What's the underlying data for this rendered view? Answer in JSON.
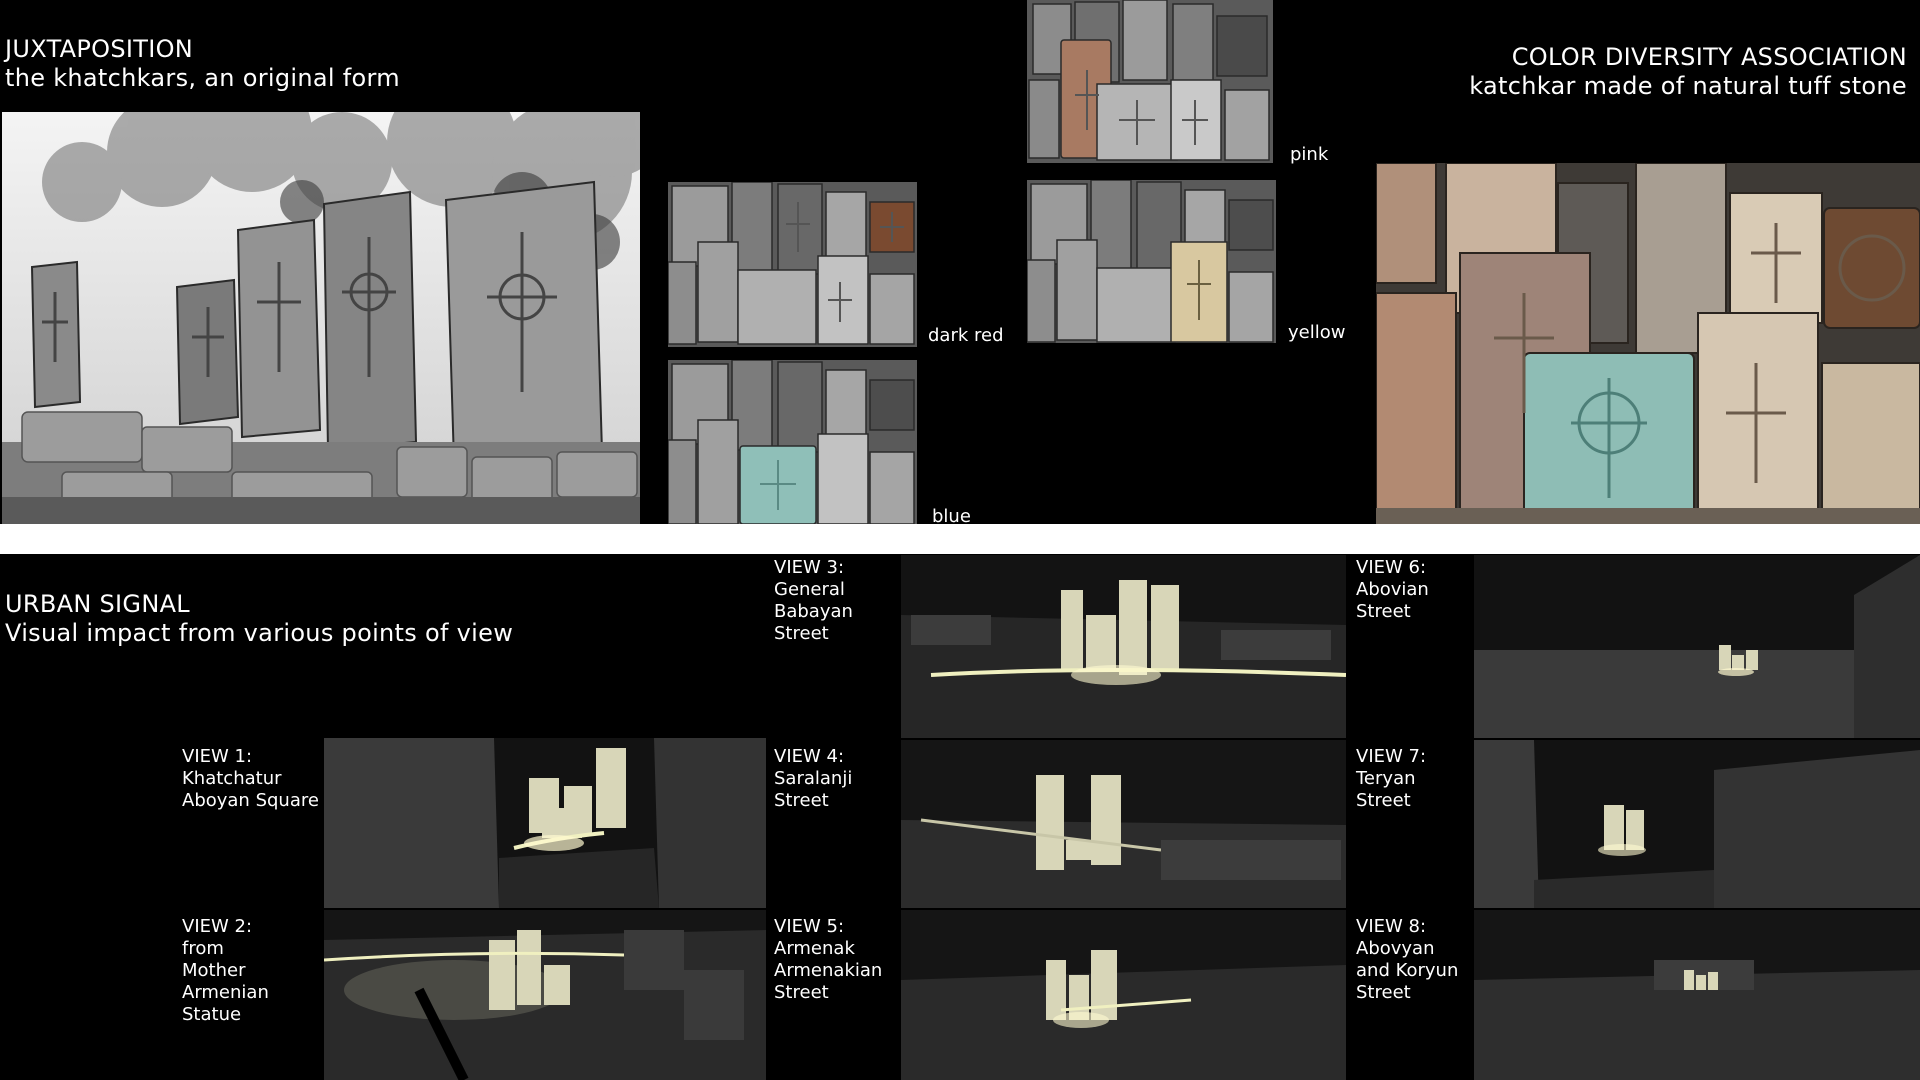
{
  "juxtaposition": {
    "title": "JUXTAPOSITION",
    "subtitle": "the khatchkars, an original form"
  },
  "color_diversity": {
    "title": "COLOR DIVERSITY ASSOCIATION",
    "subtitle": "katchkar made of natural tuff stone"
  },
  "swatches": [
    {
      "label": "pink",
      "accent": "#a87a62"
    },
    {
      "label": "dark red",
      "accent": "#7a4a30"
    },
    {
      "label": "yellow",
      "accent": "#d8c8a0"
    },
    {
      "label": "blue",
      "accent": "#8fbfb8"
    }
  ],
  "urban_signal": {
    "title": "URBAN SIGNAL",
    "subtitle": "Visual impact from various points of view"
  },
  "views": [
    {
      "label": "VIEW 1:\nKhatchatur\nAboyan Square"
    },
    {
      "label": "VIEW 2:\nfrom\nMother\nArmenian\nStatue"
    },
    {
      "label": "VIEW 3:\nGeneral\nBabayan\nStreet"
    },
    {
      "label": "VIEW 4:\nSaralanji\nStreet"
    },
    {
      "label": "VIEW 5:\nArmenak\nArmenakian\nStreet"
    },
    {
      "label": "VIEW 6:\nAbovian\nStreet"
    },
    {
      "label": "VIEW 7:\nTeryan\nStreet"
    },
    {
      "label": "VIEW 8:\nAbovyan\nand Koryun\nStreet"
    }
  ]
}
